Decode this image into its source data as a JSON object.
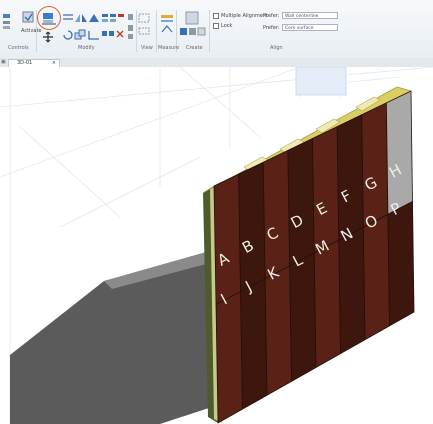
{
  "ribbon": {
    "groups": [
      {
        "name": "Controls"
      },
      {
        "name": "Modify"
      },
      {
        "name": "View"
      },
      {
        "name": "Measure"
      },
      {
        "name": "Create"
      },
      {
        "name": "Align"
      }
    ],
    "tools": {
      "activate_label": "Activate",
      "multiple_alignment_label": "Multiple Alignment",
      "lock_label": "Lock",
      "prefer_label": "Prefer:",
      "prefer_value": "Wall centerline",
      "prefer2_label": "Prefer:",
      "prefer2_value": "Core surface"
    }
  },
  "tabs": {
    "view_tab_label": "3D-01"
  },
  "panels": {
    "top_row": [
      "A",
      "B",
      "C",
      "D",
      "E",
      "F",
      "G",
      "H"
    ],
    "bottom_row": [
      "I",
      "J",
      "K",
      "L",
      "M",
      "N",
      "O",
      "P"
    ]
  },
  "colors": {
    "panel": "#5a2216",
    "panel_dark": "#3d160d",
    "gray_panel": "#a9a9a9",
    "insulation": "#d9cf63",
    "shadow": "#5b5b5b",
    "accent_ring": "#e0652a"
  }
}
